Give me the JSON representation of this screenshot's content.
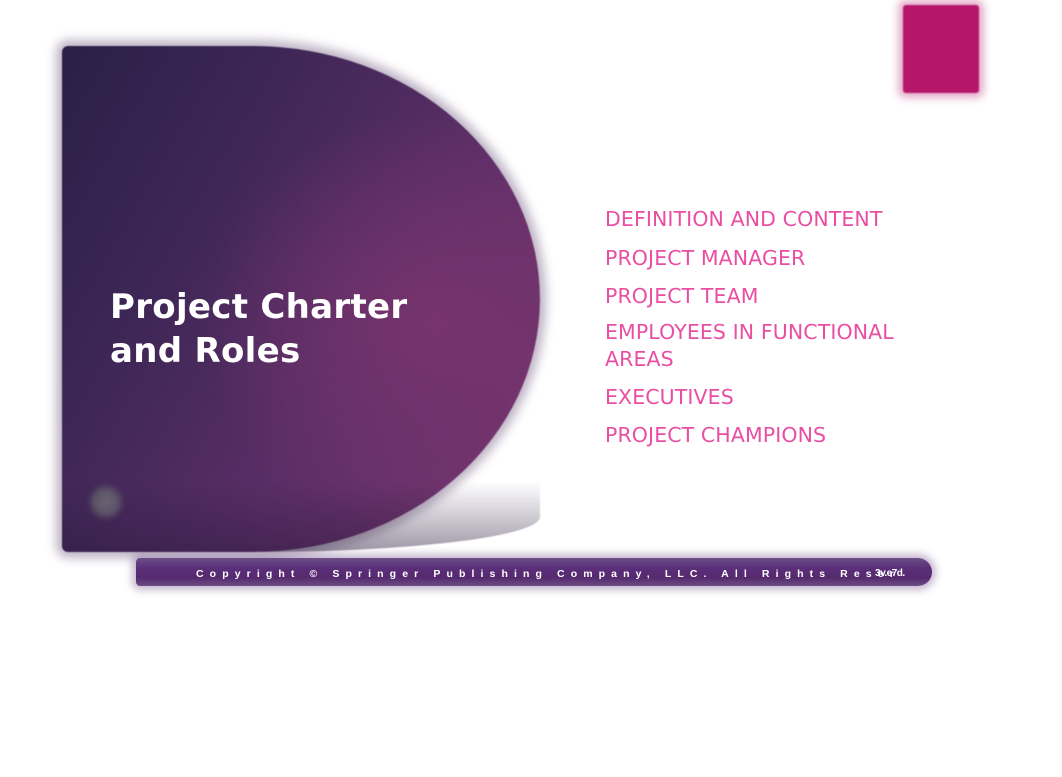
{
  "slide": {
    "title": "Project Charter and Roles",
    "agenda_items": [
      "DEFINITION AND CONTENT",
      "PROJECT MANAGER",
      "PROJECT TEAM",
      "EMPLOYEES IN FUNCTIONAL AREAS",
      "EXECUTIVES",
      "PROJECT CHAMPIONS"
    ],
    "footer": {
      "copyright": "Copyright © Springer Publishing Company, LLC. All Rights Reser",
      "slide_number": "3",
      "copyright_tail_overlap": "v.e7d."
    }
  },
  "colors": {
    "panel_purple_dark": "#2a1f47",
    "panel_purple_light": "#6e336c",
    "accent_magenta": "#b5166a",
    "agenda_pink": "#ea4ea3",
    "footer_purple": "#5b2f7a",
    "title_text": "#ffffff"
  }
}
